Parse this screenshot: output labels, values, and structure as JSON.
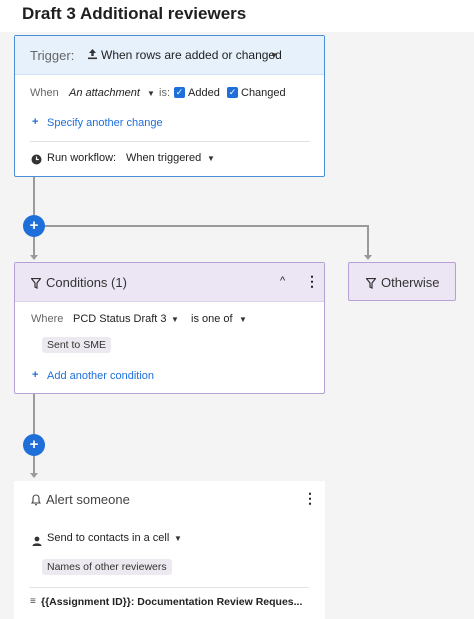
{
  "page": {
    "title": "Draft 3 Additional reviewers"
  },
  "trigger": {
    "label": "Trigger:",
    "value": "When rows are added or changed",
    "when_label": "When",
    "when_value": "An attachment",
    "is_label": "is:",
    "added_label": "Added",
    "changed_label": "Changed",
    "added_checked": true,
    "changed_checked": true,
    "specify_link": "Specify another change",
    "run_label": "Run workflow:",
    "run_value": "When triggered"
  },
  "conditions": {
    "title": "Conditions (1)",
    "where_label": "Where",
    "field": "PCD Status Draft 3",
    "operator": "is one of",
    "value_chip": "Sent to SME",
    "add_link": "Add another condition"
  },
  "otherwise": {
    "label": "Otherwise"
  },
  "alert": {
    "title": "Alert someone",
    "send_to": "Send to contacts in a cell",
    "chip": "Names of other reviewers",
    "subject": "{{Assignment ID}}: Documentation Review Reques..."
  },
  "icons": {
    "plus": "+",
    "filter": "filter-icon",
    "bell": "bell-icon",
    "person": "person-icon",
    "clock": "clock-icon",
    "upload": "upload-icon",
    "more": "more-vert-icon",
    "collapse": "chevron-up-icon"
  },
  "colors": {
    "accent": "#1e6fd9",
    "trigger_border": "#4a90d9",
    "condition_border": "#b7a1d4",
    "condition_header": "#ebe5f4"
  }
}
